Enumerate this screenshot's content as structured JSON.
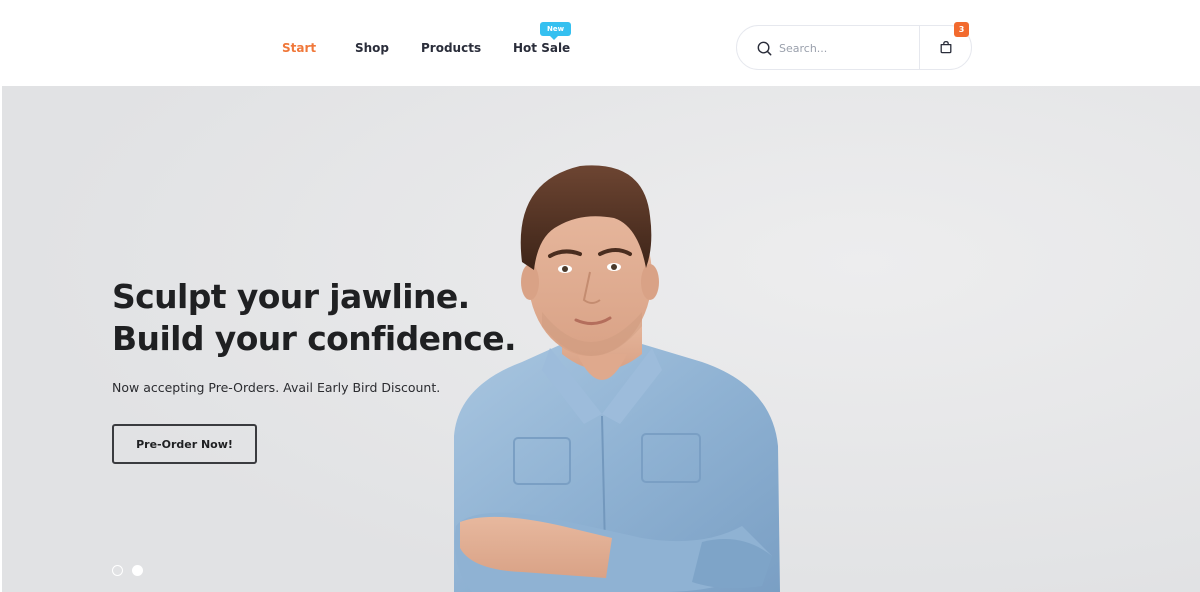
{
  "nav": {
    "items": [
      {
        "label": "Start"
      },
      {
        "label": "Shop"
      },
      {
        "label": "Products"
      },
      {
        "label": "Hot Sale",
        "badge": "New"
      }
    ]
  },
  "search": {
    "placeholder": "Search...",
    "icon": "search-icon"
  },
  "cart": {
    "count": "3",
    "icon": "shopping-bag-icon"
  },
  "hero": {
    "headline_line1": "Sculpt your jawline.",
    "headline_line2": "Build your confidence.",
    "subtext": "Now accepting Pre-Orders. Avail Early Bird Discount.",
    "cta_label": "Pre-Order Now!",
    "slides_total": 2,
    "active_slide": 2
  },
  "colors": {
    "accent": "#f0783a",
    "badge_new": "#35c0f0",
    "cart_badge": "#f26a2e",
    "text_dark": "#1f2022"
  }
}
